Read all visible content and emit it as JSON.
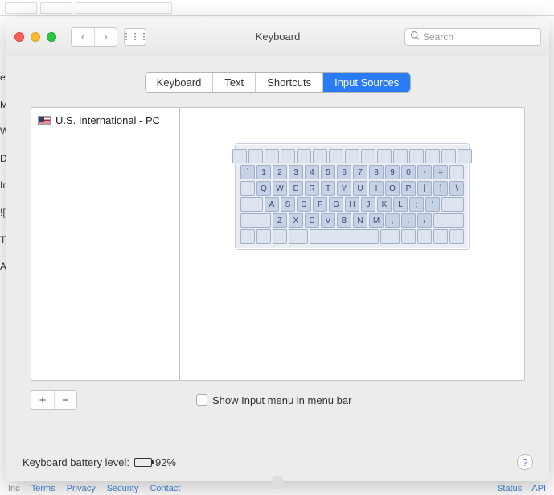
{
  "browser": {
    "letters": [
      "ey",
      "M",
      "W",
      "D",
      "In",
      "![",
      "T",
      "A"
    ]
  },
  "window": {
    "title": "Keyboard",
    "search_placeholder": "Search",
    "tabs": [
      "Keyboard",
      "Text",
      "Shortcuts",
      "Input Sources"
    ],
    "active_tab_index": 3
  },
  "sources": {
    "items": [
      {
        "flag": "us",
        "label": "U.S. International - PC"
      }
    ]
  },
  "keyboard_layout": {
    "row0": [
      "`",
      "1",
      "2",
      "3",
      "4",
      "5",
      "6",
      "7",
      "8",
      "9",
      "0",
      "-",
      "="
    ],
    "row1": [
      "Q",
      "W",
      "E",
      "R",
      "T",
      "Y",
      "U",
      "I",
      "O",
      "P",
      "[",
      "]",
      "\\"
    ],
    "row2": [
      "A",
      "S",
      "D",
      "F",
      "G",
      "H",
      "J",
      "K",
      "L",
      ";",
      "'"
    ],
    "row3": [
      "Z",
      "X",
      "C",
      "V",
      "B",
      "N",
      "M",
      ",",
      ".",
      "/"
    ]
  },
  "controls": {
    "add": "+",
    "remove": "−",
    "show_input_menu_label": "Show Input menu in menu bar",
    "show_input_menu_checked": false
  },
  "footer": {
    "battery_label": "Keyboard battery level:",
    "battery_pct": "92%",
    "battery_fill_pct": 92,
    "help": "?"
  },
  "bottom_links": {
    "left": [
      "Inc",
      "Terms",
      "Privacy",
      "Security",
      "Contact"
    ],
    "right": [
      "Status",
      "API"
    ]
  }
}
